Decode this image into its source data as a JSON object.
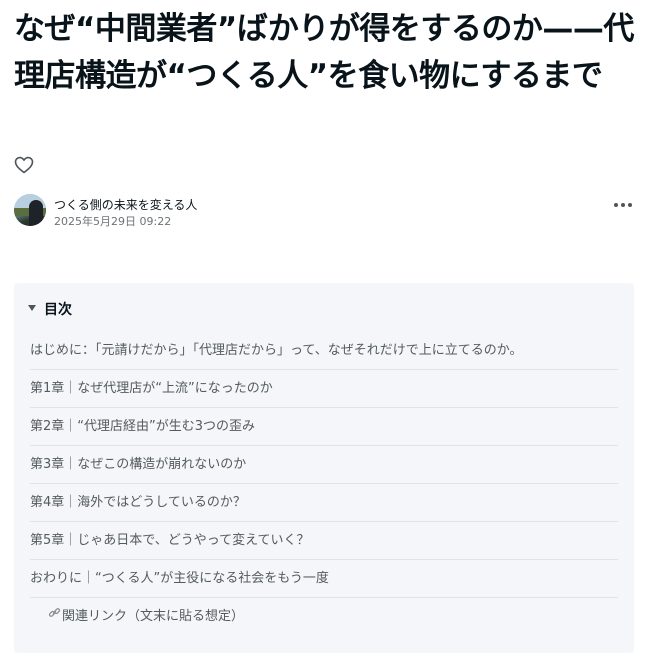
{
  "article": {
    "title": "なぜ“中間業者”ばかりが得をするのか——代理店構造が“つくる人”を食い物にするまで"
  },
  "author": {
    "name": "つくる側の未来を変える人",
    "date": "2025年5月29日 09:22"
  },
  "icons": {
    "like": "heart-icon",
    "more": "more-dots-icon",
    "toc_toggle": "caret-down-icon",
    "related": "link-icon"
  },
  "toc": {
    "heading": "目次",
    "items": [
      "はじめに：「元請けだから」「代理店だから」って、なぜそれだけで上に立てるのか。",
      "第1章｜なぜ代理店が“上流”になったのか",
      "第2章｜“代理店経由”が生む3つの歪み",
      "第3章｜なぜこの構造が崩れないのか",
      "第4章｜海外ではどうしているのか？",
      "第5章｜じゃあ日本で、どうやって変えていく？",
      "おわりに｜“つくる人”が主役になる社会をもう一度",
      "関連リンク（文末に貼る想定）"
    ]
  }
}
